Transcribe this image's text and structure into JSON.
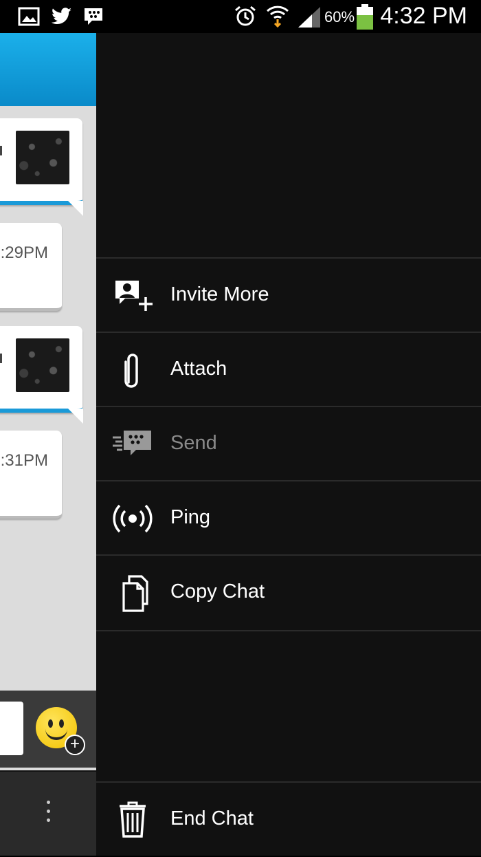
{
  "status_bar": {
    "battery_percent": "60%",
    "time": "4:32 PM",
    "icons": [
      "gallery-icon",
      "twitter-icon",
      "bbm-icon",
      "alarm-icon",
      "wifi-icon",
      "signal-icon",
      "battery-icon"
    ]
  },
  "chat": {
    "messages": [
      {
        "type": "image"
      },
      {
        "type": "text",
        "time": ":29PM"
      },
      {
        "type": "image"
      },
      {
        "type": "text",
        "time": ":31PM"
      }
    ]
  },
  "menu": {
    "items": [
      {
        "label": "Invite More",
        "icon": "invite-icon",
        "enabled": true
      },
      {
        "label": "Attach",
        "icon": "paperclip-icon",
        "enabled": true
      },
      {
        "label": "Send",
        "icon": "bbm-send-icon",
        "enabled": false
      },
      {
        "label": "Ping",
        "icon": "ping-icon",
        "enabled": true
      },
      {
        "label": "Copy Chat",
        "icon": "copy-icon",
        "enabled": true
      }
    ],
    "end_chat": {
      "label": "End Chat",
      "icon": "trash-icon"
    }
  },
  "colors": {
    "header_blue": "#1bb0ea",
    "menu_bg": "#111111",
    "divider": "#2b2b2b",
    "disabled_text": "#8a8a8a"
  }
}
